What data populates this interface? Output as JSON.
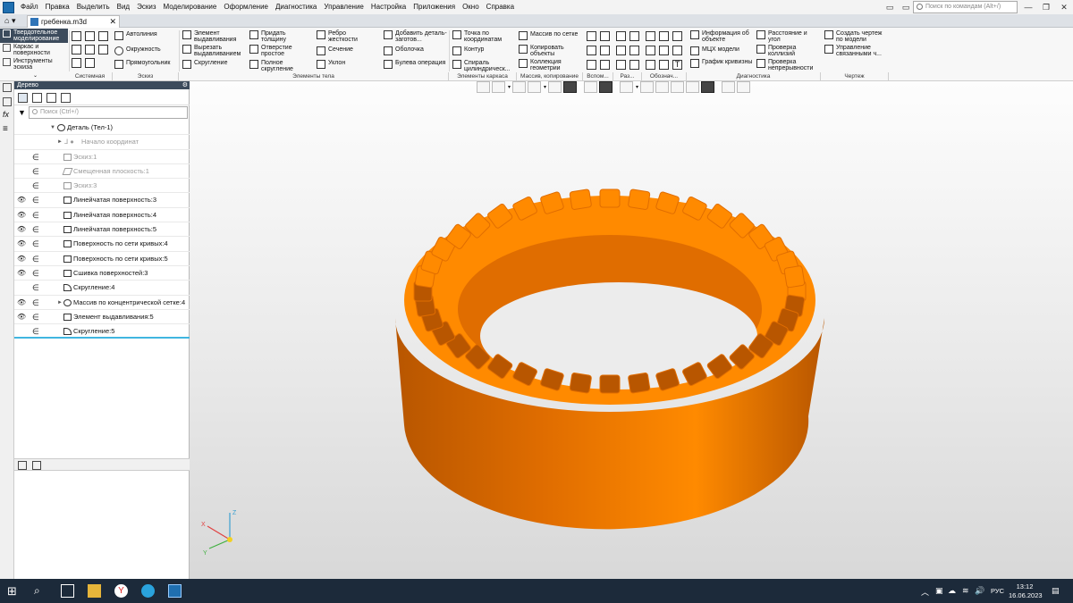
{
  "menu": [
    "Файл",
    "Правка",
    "Выделить",
    "Вид",
    "Эскиз",
    "Моделирование",
    "Оформление",
    "Диагностика",
    "Управление",
    "Настройка",
    "Приложения",
    "Окно",
    "Справка"
  ],
  "search": {
    "placeholder": "Поиск по командам (Alt+/)"
  },
  "document": {
    "tab_title": "гребенка.m3d"
  },
  "modes": [
    "Твердотельное моделирование",
    "Каркас и поверхности",
    "Инструменты эскиза"
  ],
  "ribbon": {
    "system": {
      "group": "Системная"
    },
    "sketch": {
      "autoline": "Автолиния",
      "circle": "Окружность",
      "rectangle": "Прямоугольник",
      "group": "Эскиз"
    },
    "body": {
      "extrude": "Элемент выдавливания",
      "cut_extrude": "Вырезать выдавливанием",
      "fillet": "Скругление",
      "thicken": "Придать толщину",
      "hole": "Отверстие простое",
      "full_round": "Полное скругление",
      "rib": "Ребро жесткости",
      "section": "Сечение",
      "draft": "Уклон",
      "add_part": "Добавить деталь-заготов...",
      "shell": "Оболочка",
      "boolean": "Булева операция",
      "group": "Элементы тела"
    },
    "wire": {
      "point": "Точка по координатам",
      "contour": "Контур",
      "spiral": "Спираль цилиндрическ...",
      "group": "Элементы каркаса"
    },
    "pattern": {
      "grid": "Массив по сетке",
      "copy": "Копировать объекты",
      "collection": "Коллекция геометрии",
      "group": "Массив, копирование"
    },
    "aux": {
      "group": "Вспом..."
    },
    "sizes": {
      "group": "Раз..."
    },
    "notation": {
      "group": "Обознач..."
    },
    "diag": {
      "info": "Информация об объекте",
      "distance": "Расстояние и угол",
      "mcx": "МЦХ модели",
      "collisions": "Проверка коллизий",
      "curvature": "График кривизны",
      "continuity": "Проверка непрерывности",
      "group": "Диагностика"
    },
    "drawing": {
      "create": "Создать чертеж по модели",
      "linked": "Управление связанными ч...",
      "group": "Чертеж"
    }
  },
  "tree": {
    "title": "Дерево",
    "search_placeholder": "Поиск (Ctrl+/)",
    "rows": [
      {
        "label": "Деталь (Тел-1)"
      },
      {
        "label": "Начало координат"
      },
      {
        "label": "Эскиз:1"
      },
      {
        "label": "Смещенная плоскость:1"
      },
      {
        "label": "Эскиз:3"
      },
      {
        "label": "Линейчатая поверхность:3"
      },
      {
        "label": "Линейчатая поверхность:4"
      },
      {
        "label": "Линейчатая поверхность:5"
      },
      {
        "label": "Поверхность по сети кривых:4"
      },
      {
        "label": "Поверхность по сети кривых:5"
      },
      {
        "label": "Сшивка поверхностей:3"
      },
      {
        "label": "Скругление:4"
      },
      {
        "label": "Массив по концентрической сетке:4"
      },
      {
        "label": "Элемент выдавливания:5"
      },
      {
        "label": "Скругление:5"
      }
    ]
  },
  "model": {
    "color": "#ff8a00",
    "shade": "#e06d00",
    "dark": "#b85600",
    "teeth": 40
  },
  "axes": {
    "x": "X",
    "y": "Y",
    "z": "Z"
  },
  "taskbar": {
    "lang": "РУС",
    "time": "13:12",
    "date": "16.06.2023"
  }
}
